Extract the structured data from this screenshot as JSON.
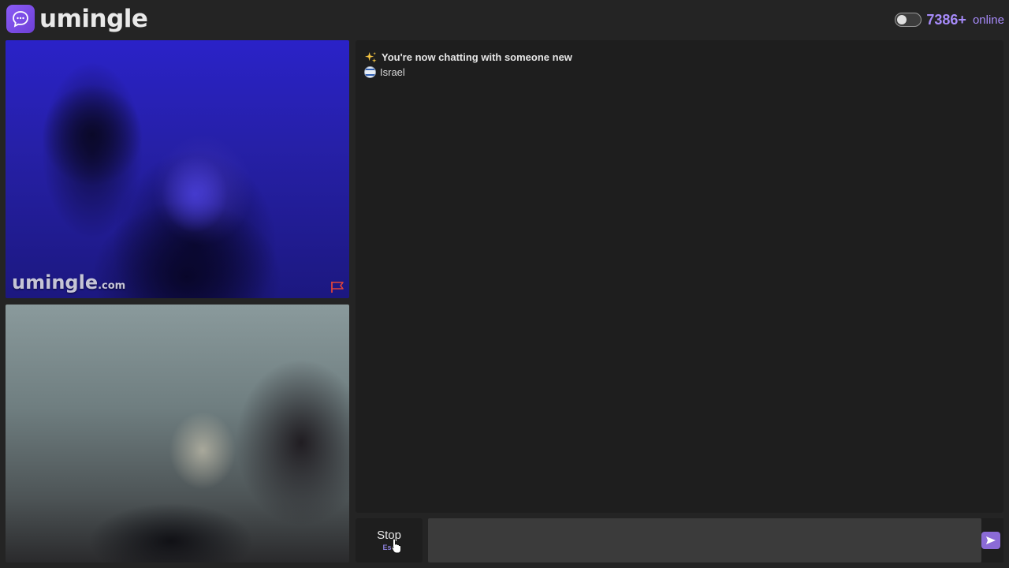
{
  "brand": {
    "name": "umingle",
    "watermark_main": "umingle",
    "watermark_suffix": ".com",
    "icon": "chat-bubble-icon",
    "accent_color": "#a78bfa"
  },
  "header": {
    "online_count": "7386+",
    "online_label": "online",
    "theme_toggle_on": false
  },
  "videos": {
    "remote": {
      "report_icon": "flag-icon",
      "report_color": "#e0443a"
    },
    "local": {}
  },
  "chat": {
    "system_icon": "sparkles-icon",
    "system_message": "You're now chatting with someone new",
    "stranger_country": "Israel",
    "stranger_flag_icon": "israel-flag-icon"
  },
  "controls": {
    "stop_label": "Stop",
    "stop_key": "Esc",
    "message_placeholder": "",
    "send_icon": "send-icon"
  }
}
